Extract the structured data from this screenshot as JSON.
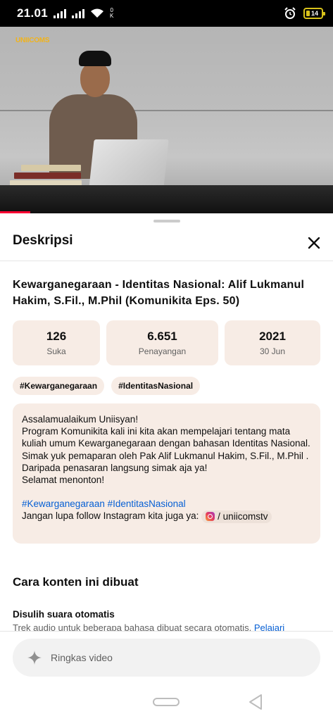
{
  "status_bar": {
    "time": "21.01",
    "battery_level": "14",
    "speed_top": "0",
    "speed_bottom": "K"
  },
  "video": {
    "logo_text": "UNIICOMS",
    "progress_fraction": 0.09
  },
  "sheet": {
    "title": "Deskripsi",
    "close_icon": "close-icon"
  },
  "video_title": "Kewarganegaraan - Identitas Nasional: Alif Lukmanul Hakim, S.Fil., M.Phil (Komunikita Eps. 50)",
  "stats": [
    {
      "value": "126",
      "label": "Suka"
    },
    {
      "value": "6.651",
      "label": "Penayangan"
    },
    {
      "value": "2021",
      "label": "30 Jun"
    }
  ],
  "tags": [
    "#Kewarganegaraan",
    "#IdentitasNasional"
  ],
  "description": {
    "line1": "Assalamualaikum Uniisyan!",
    "line2": "Program Komunikita kali ini kita akan mempelajari tentang mata kuliah umum Kewarganegaraan dengan bahasan Identitas Nasional.",
    "line3": "Simak yuk pemaparan oleh Pak Alif Lukmanul Hakim, S.Fil., M.Phil . Daripada penasaran langsung simak aja ya!",
    "line4": "Selamat menonton!",
    "hashtags": "#Kewarganegaraan #IdentitasNasional",
    "follow_text": "Jangan lupa follow Instagram kita juga ya:",
    "ig_handle": "/ uniicomstv"
  },
  "how_made": {
    "title": "Cara konten ini dibuat",
    "subtitle": "Disulih suara otomatis",
    "text": "Trek audio untuk beberapa bahasa dibuat secara otomatis.",
    "link": "Pelajari"
  },
  "summarize": {
    "label": "Ringkas video",
    "icon": "sparkle-icon"
  },
  "colors": {
    "accent_red": "#ff0033",
    "chip_bg": "#f7ece5",
    "link_blue": "#065fd4"
  }
}
